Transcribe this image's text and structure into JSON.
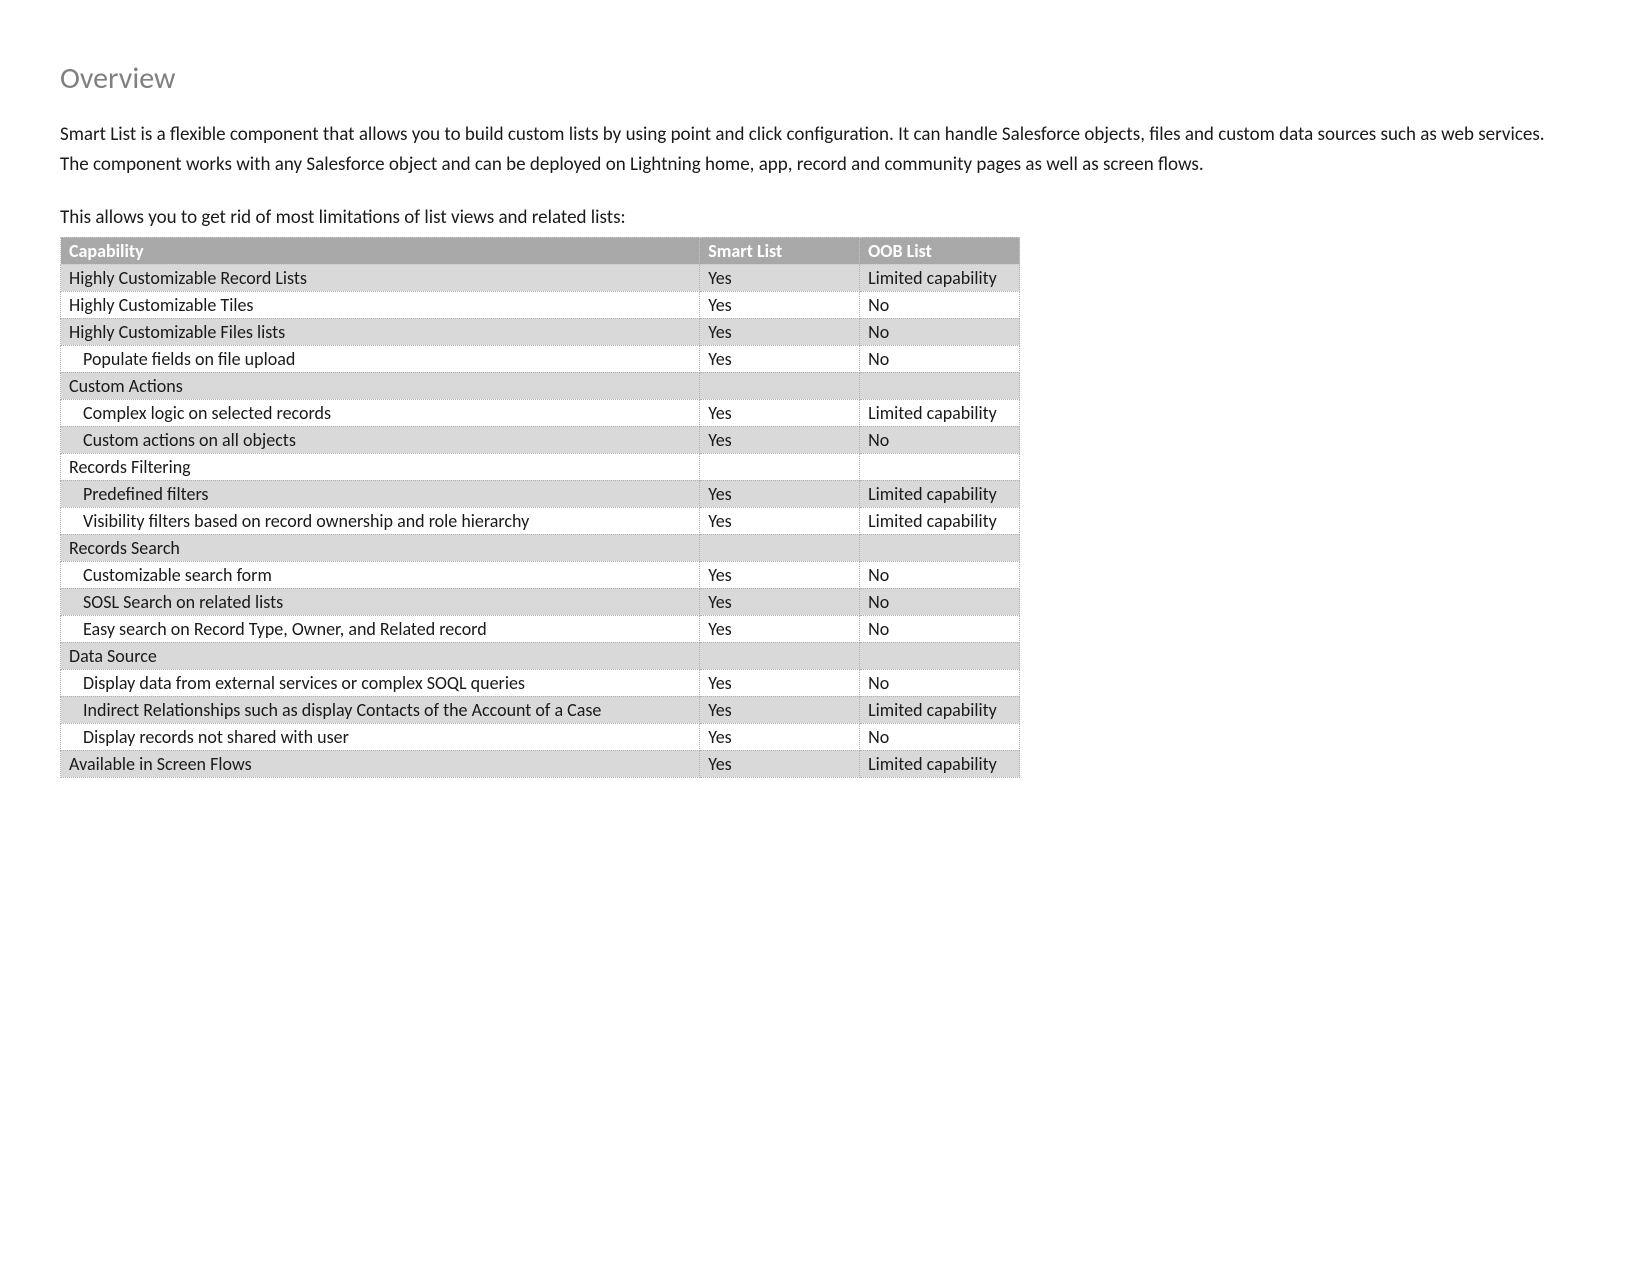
{
  "title": "Overview",
  "paragraphs": {
    "p1": "Smart List is a flexible component that allows you to build custom lists by using point and click configuration. It can handle Salesforce objects, files and custom data sources such as web services.",
    "p2": "The component works with any Salesforce object and can be deployed on Lightning home, app, record and community pages as well as screen flows.",
    "p3": "This allows you to get rid of most limitations of list views and related lists:"
  },
  "table": {
    "header": {
      "capability": "Capability",
      "smart": "Smart List",
      "oob": "OOB List"
    },
    "rows": [
      {
        "style": "shaded",
        "indent": 0,
        "capability": "Highly Customizable Record Lists",
        "smart": "Yes",
        "oob": "Limited capability"
      },
      {
        "style": "plain",
        "indent": 0,
        "capability": "Highly Customizable Tiles",
        "smart": "Yes",
        "oob": "No"
      },
      {
        "style": "shaded",
        "indent": 0,
        "capability": "Highly Customizable Files lists",
        "smart": "Yes",
        "oob": "No"
      },
      {
        "style": "plain",
        "indent": 1,
        "capability": "Populate fields on file upload",
        "smart": "Yes",
        "oob": "No"
      },
      {
        "style": "shaded",
        "indent": 0,
        "capability": "Custom Actions",
        "smart": "",
        "oob": ""
      },
      {
        "style": "plain",
        "indent": 1,
        "capability": "Complex logic on selected records",
        "smart": "Yes",
        "oob": "Limited capability"
      },
      {
        "style": "shaded",
        "indent": 1,
        "capability": "Custom actions on all objects",
        "smart": "Yes",
        "oob": "No"
      },
      {
        "style": "plain",
        "indent": 0,
        "capability": "Records Filtering",
        "smart": "",
        "oob": ""
      },
      {
        "style": "shaded",
        "indent": 1,
        "capability": "Predefined filters",
        "smart": "Yes",
        "oob": "Limited capability"
      },
      {
        "style": "plain",
        "indent": 1,
        "capability": "Visibility filters based on record ownership and role hierarchy",
        "smart": "Yes",
        "oob": "Limited capability"
      },
      {
        "style": "shaded",
        "indent": 0,
        "capability": "Records Search",
        "smart": "",
        "oob": ""
      },
      {
        "style": "plain",
        "indent": 1,
        "capability": "Customizable search form",
        "smart": "Yes",
        "oob": "No"
      },
      {
        "style": "shaded",
        "indent": 1,
        "capability": "SOSL Search on related lists",
        "smart": "Yes",
        "oob": "No"
      },
      {
        "style": "plain",
        "indent": 1,
        "capability": "Easy search on Record Type, Owner, and Related record",
        "smart": "Yes",
        "oob": "No"
      },
      {
        "style": "shaded",
        "indent": 0,
        "capability": "Data Source",
        "smart": "",
        "oob": ""
      },
      {
        "style": "plain",
        "indent": 1,
        "capability": "Display data from external services or complex SOQL queries",
        "smart": "Yes",
        "oob": "No"
      },
      {
        "style": "shaded",
        "indent": 1,
        "capability": "Indirect Relationships such as display Contacts of the Account of a Case",
        "smart": "Yes",
        "oob": "Limited capability"
      },
      {
        "style": "plain",
        "indent": 1,
        "capability": "Display records not shared with user",
        "smart": "Yes",
        "oob": "No"
      },
      {
        "style": "shaded",
        "indent": 0,
        "capability": "Available in Screen Flows",
        "smart": "Yes",
        "oob": "Limited capability"
      }
    ]
  }
}
